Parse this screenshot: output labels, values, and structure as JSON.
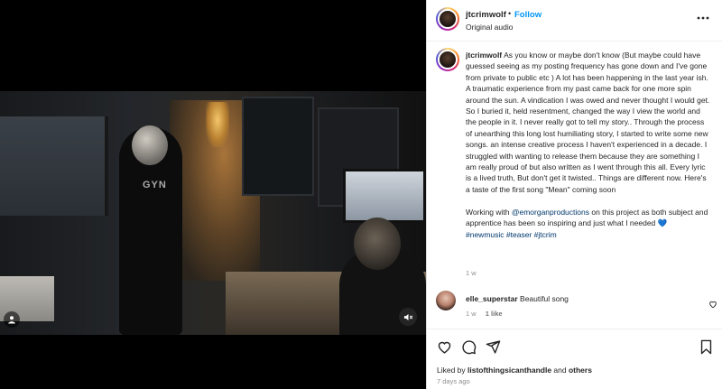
{
  "post": {
    "username": "jtcrimwolf",
    "separator": "•",
    "follow_label": "Follow",
    "audio_label": "Original audio",
    "media": {
      "shirt_text": "GYN",
      "user_tag_icon": "person-icon",
      "mute_icon": "speaker-muted-icon"
    }
  },
  "caption": {
    "username": "jtcrimwolf",
    "body": "As you know or maybe don't know (But maybe could have guessed seeing as my posting frequency has gone down and I've gone from private to public etc ) A lot has been happening in the last year ish. A traumatic experience from my past came back for one more spin around the sun. A vindication I was owed and never thought I would get. So I buried it, held resentment, changed the way I view the world and the people in it. I never really got to tell my story.. Through the process of unearthing this long lost humiliating story, I started to write some new songs. an intense creative process I haven't experienced in a decade. I struggled with wanting to release them because they are something I am really proud of but also written as I went through this all. Every lyric is a lived truth, But don't get it twisted.. Things are different now. Here's a taste of the first song \"Mean\" coming soon",
    "working_prefix": "Working with ",
    "mention": "@emorganproductions",
    "working_suffix": " on this project as both subject and apprentice has been so inspiring and just what I needed 💙",
    "hashtags": [
      "#newmusic",
      "#teaser",
      "#jtcrim"
    ],
    "time": "1 w"
  },
  "comments": [
    {
      "username": "elle_superstar",
      "text": "Beautiful song",
      "time": "1 w",
      "like_label": "1 like"
    }
  ],
  "actions": {
    "like_icon": "heart-icon",
    "comment_icon": "comment-icon",
    "share_icon": "send-icon",
    "save_icon": "bookmark-icon"
  },
  "likes": {
    "prefix": "Liked by ",
    "user": "listofthingsicanthandle",
    "middle": " and ",
    "others": "others"
  },
  "posted": "7 days ago"
}
